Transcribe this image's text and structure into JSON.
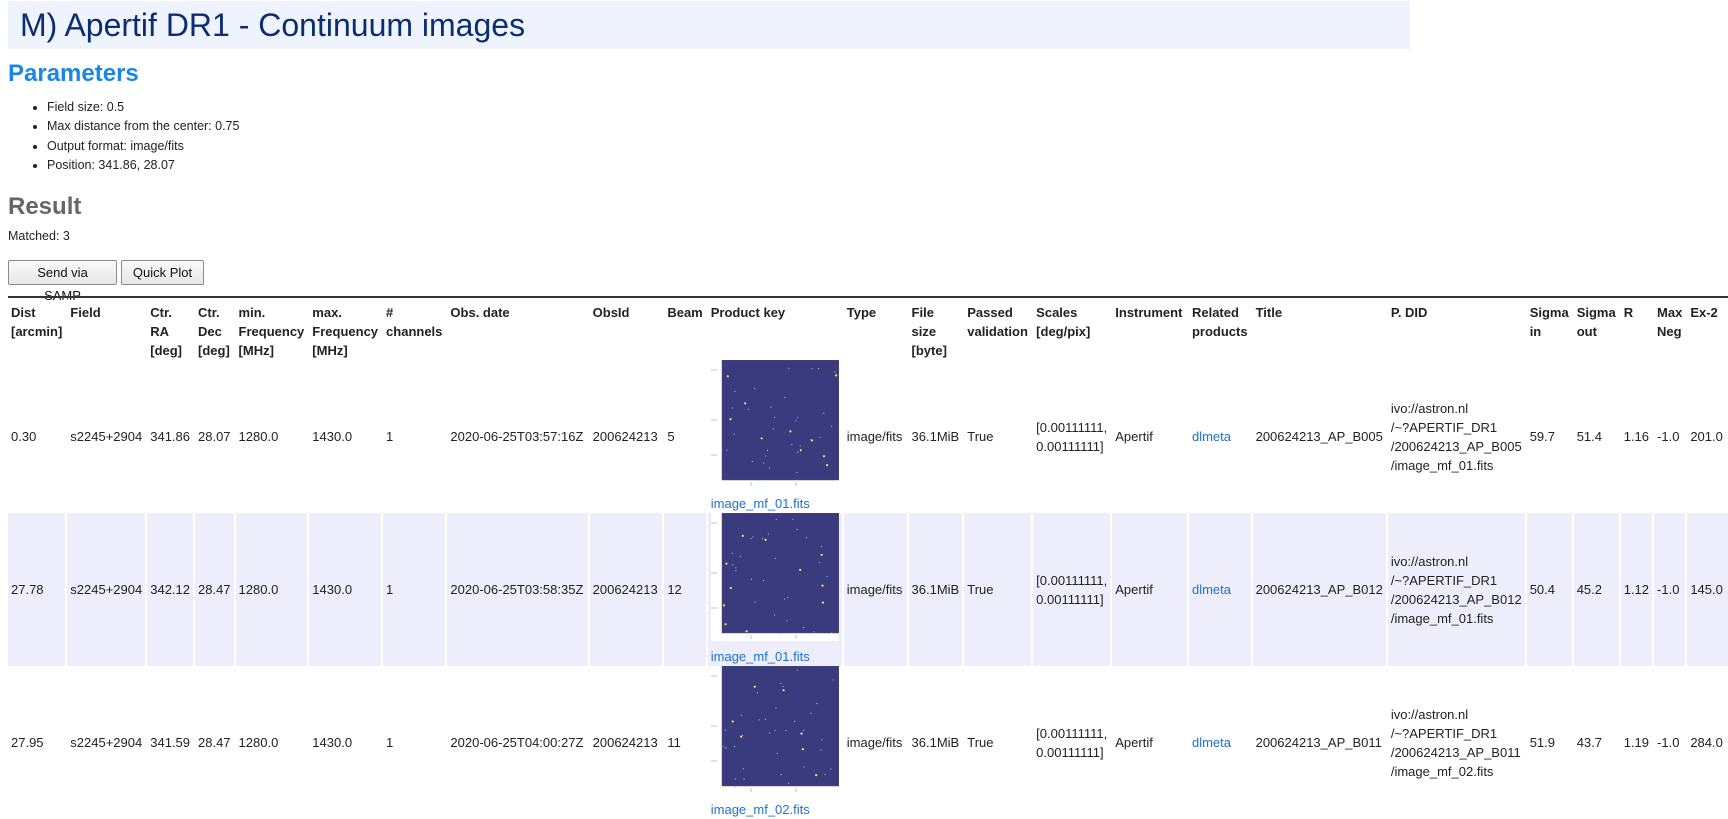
{
  "page": {
    "title": "M) Apertif DR1 - Continuum images",
    "parameters_heading": "Parameters",
    "parameters": [
      "Field size: 0.5",
      "Max distance from the center: 0.75",
      "Output format: image/fits",
      "Position: 341.86, 28.07"
    ],
    "result_heading": "Result",
    "matched": "Matched: 3",
    "buttons": {
      "samp": "Send via SAMP",
      "plot": "Quick Plot"
    }
  },
  "table": {
    "headers": {
      "dist": [
        "Dist",
        "[arcmin]"
      ],
      "field": [
        "Field"
      ],
      "ra": [
        "Ctr.",
        "RA",
        "[deg]"
      ],
      "dec": [
        "Ctr.",
        "Dec",
        "[deg]"
      ],
      "minf": [
        "min.",
        "Frequency",
        "[MHz]"
      ],
      "maxf": [
        "max.",
        "Frequency",
        "[MHz]"
      ],
      "chan": [
        "#",
        "channels"
      ],
      "obsdate": [
        "Obs. date"
      ],
      "obsid": [
        "ObsId"
      ],
      "beam": [
        "Beam"
      ],
      "pkey": [
        "Product key"
      ],
      "type": [
        "Type"
      ],
      "fsize": [
        "File",
        "size",
        "[byte]"
      ],
      "passed": [
        "Passed",
        "validation"
      ],
      "scales": [
        "Scales",
        "[deg/pix]"
      ],
      "instr": [
        "Instrument"
      ],
      "related": [
        "Related",
        "products"
      ],
      "title": [
        "Title"
      ],
      "pdid": [
        "P. DID"
      ],
      "sigin": [
        "Sigma",
        "in"
      ],
      "sigout": [
        "Sigma",
        "out"
      ],
      "r": [
        "R"
      ],
      "maxneg": [
        "Max",
        "Neg"
      ],
      "ex2": [
        "Ex-2"
      ]
    },
    "rows": [
      {
        "dist": "0.30",
        "field": "s2245+2904",
        "ra": "341.86",
        "dec": "28.07",
        "minf": "1280.0",
        "maxf": "1430.0",
        "chan": "1",
        "obsdate": "2020-06-25T03:57:16Z",
        "obsid": "200624213",
        "beam": "5",
        "pkey": "image_mf_01.fits",
        "type": "image/fits",
        "fsize": "36.1MiB",
        "passed": "True",
        "scales": [
          "[0.00111111,",
          "0.00111111]"
        ],
        "instr": "Apertif",
        "related": "dlmeta",
        "title": "200624213_AP_B005",
        "pdid": [
          "ivo://astron.nl",
          "/~?APERTIF_DR1",
          "/200624213_AP_B005",
          "/image_mf_01.fits"
        ],
        "sigin": "59.7",
        "sigout": "51.4",
        "r": "1.16",
        "maxneg": "-1.0",
        "ex2": "201.0"
      },
      {
        "dist": "27.78",
        "field": "s2245+2904",
        "ra": "342.12",
        "dec": "28.47",
        "minf": "1280.0",
        "maxf": "1430.0",
        "chan": "1",
        "obsdate": "2020-06-25T03:58:35Z",
        "obsid": "200624213",
        "beam": "12",
        "pkey": "image_mf_01.fits",
        "type": "image/fits",
        "fsize": "36.1MiB",
        "passed": "True",
        "scales": [
          "[0.00111111,",
          "0.00111111]"
        ],
        "instr": "Apertif",
        "related": "dlmeta",
        "title": "200624213_AP_B012",
        "pdid": [
          "ivo://astron.nl",
          "/~?APERTIF_DR1",
          "/200624213_AP_B012",
          "/image_mf_01.fits"
        ],
        "sigin": "50.4",
        "sigout": "45.2",
        "r": "1.12",
        "maxneg": "-1.0",
        "ex2": "145.0"
      },
      {
        "dist": "27.95",
        "field": "s2245+2904",
        "ra": "341.59",
        "dec": "28.47",
        "minf": "1280.0",
        "maxf": "1430.0",
        "chan": "1",
        "obsdate": "2020-06-25T04:00:27Z",
        "obsid": "200624213",
        "beam": "11",
        "pkey": "image_mf_02.fits",
        "type": "image/fits",
        "fsize": "36.1MiB",
        "passed": "True",
        "scales": [
          "[0.00111111,",
          "0.00111111]"
        ],
        "instr": "Apertif",
        "related": "dlmeta",
        "title": "200624213_AP_B011",
        "pdid": [
          "ivo://astron.nl",
          "/~?APERTIF_DR1",
          "/200624213_AP_B011",
          "/image_mf_02.fits"
        ],
        "sigin": "51.9",
        "sigout": "43.7",
        "r": "1.19",
        "maxneg": "-1.0",
        "ex2": "284.0"
      }
    ]
  },
  "colors": {
    "title_bg": "#eef3fd",
    "title_text": "#0b2e72",
    "param_heading": "#1a86e8",
    "link": "#1a72d6",
    "row_alt": "#ededfb",
    "thumb_bg": "#3a3b7e"
  }
}
